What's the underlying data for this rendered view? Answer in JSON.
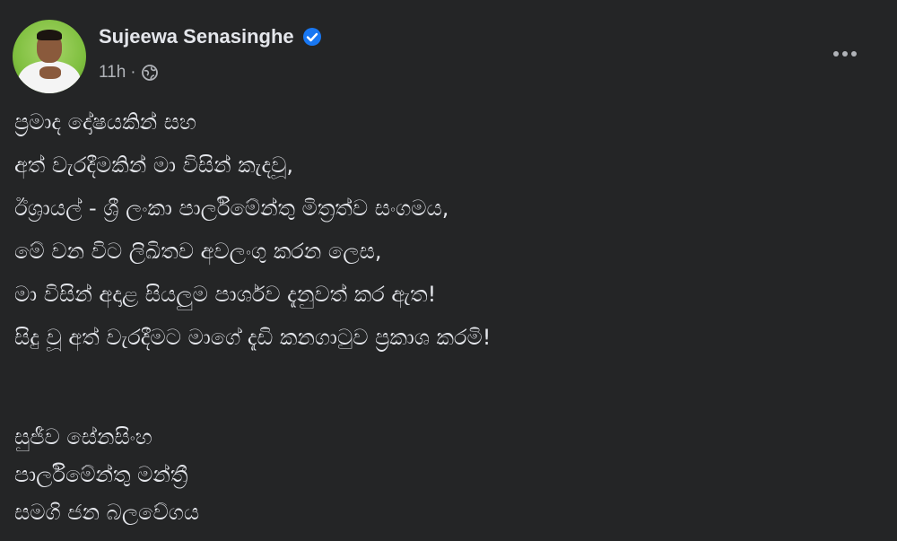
{
  "post": {
    "author": "Sujeewa Senasinghe",
    "timestamp": "11h",
    "separator": "·",
    "privacy_icon": "globe-icon",
    "verified_icon": "verified-badge-icon",
    "more_icon": "more-options-icon"
  },
  "message": {
    "lines": [
      "ප්‍රමාද දෝෂයකින් සහ",
      "අත් වැරදීමකින් මා විසින් කැදවූ,",
      "ඊශ්‍රායල් - ශ්‍රී ලංකා පාර්ලිමේන්තු මිත්‍රත්ව සංගමය,",
      "මේ වන විට ලිඛිතව අවලංගු කරන ලෙස,",
      "මා විසින් අදාළ සියලුම පාර්ශව දැනුවත් කර ඇත!",
      "සිදු වූ අත් වැරදීමට මාගේ දැඩි කනගාටුව ප්‍රකාශ කරමි!"
    ],
    "signature": [
      "සුජීව සේනසිංහ",
      "පාර්ලිමේන්තු මන්ත්‍රී",
      "සමගි ජන බලවේගය"
    ]
  },
  "colors": {
    "background": "#242526",
    "primary_text": "#e4e6eb",
    "secondary_text": "#b0b3b8",
    "verified_blue": "#1877f2"
  }
}
